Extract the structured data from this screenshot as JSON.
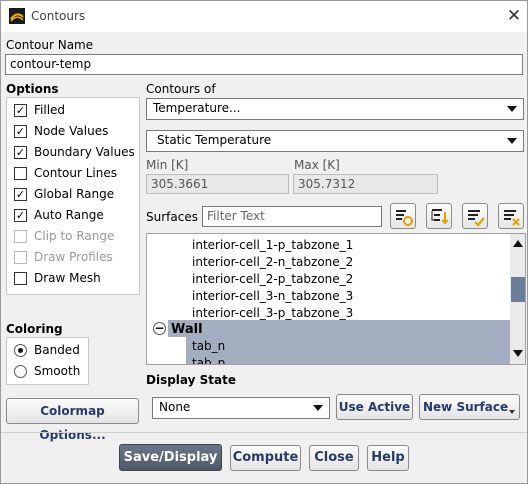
{
  "window": {
    "title": "Contours"
  },
  "contour_name": {
    "label": "Contour Name",
    "value": "contour-temp"
  },
  "options": {
    "label": "Options",
    "items": [
      {
        "label": "Filled",
        "checked": true,
        "enabled": true
      },
      {
        "label": "Node Values",
        "checked": true,
        "enabled": true
      },
      {
        "label": "Boundary Values",
        "checked": true,
        "enabled": true
      },
      {
        "label": "Contour Lines",
        "checked": false,
        "enabled": true
      },
      {
        "label": "Global Range",
        "checked": true,
        "enabled": true
      },
      {
        "label": "Auto Range",
        "checked": true,
        "enabled": true
      },
      {
        "label": "Clip to Range",
        "checked": false,
        "enabled": false
      },
      {
        "label": "Draw Profiles",
        "checked": false,
        "enabled": false
      },
      {
        "label": "Draw Mesh",
        "checked": false,
        "enabled": true
      }
    ]
  },
  "coloring": {
    "label": "Coloring",
    "items": [
      {
        "label": "Banded",
        "selected": true
      },
      {
        "label": "Smooth",
        "selected": false
      }
    ]
  },
  "colormap_button": "Colormap Options...",
  "contours_of": {
    "label": "Contours of",
    "category": "Temperature...",
    "quantity": "Static Temperature"
  },
  "range": {
    "min_label": "Min [K]",
    "min_value": "305.3661",
    "max_label": "Max [K]",
    "max_value": "305.7312"
  },
  "surfaces": {
    "label": "Surfaces",
    "filter_placeholder": "Filter Text",
    "items": [
      {
        "text": "interior-cell_1-p_tabzone_1",
        "selected": false
      },
      {
        "text": "interior-cell_2-n_tabzone_2",
        "selected": false
      },
      {
        "text": "interior-cell_2-p_tabzone_2",
        "selected": false
      },
      {
        "text": "interior-cell_3-n_tabzone_3",
        "selected": false
      },
      {
        "text": "interior-cell_3-p_tabzone_3",
        "selected": false
      }
    ],
    "group": {
      "label": "Wall",
      "toggle": "−"
    },
    "group_items": [
      {
        "text": "tab_n",
        "selected": true
      },
      {
        "text": "tab_p",
        "selected": true
      }
    ]
  },
  "display_state": {
    "label": "Display State",
    "value": "None",
    "use_active": "Use Active",
    "new_surface": "New Surface"
  },
  "footer": {
    "save_display": "Save/Display",
    "compute": "Compute",
    "close": "Close",
    "help": "Help"
  },
  "colors": {
    "selection": "#a3afc0",
    "primary_button": "#5d6878",
    "button_text": "#243b6b",
    "toolbar_accent": "#e0a400"
  }
}
